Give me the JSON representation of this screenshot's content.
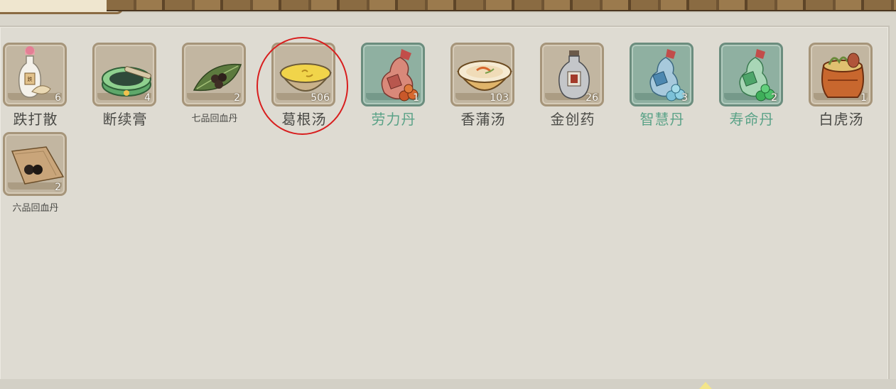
{
  "inventory": {
    "items": [
      {
        "name": "跌打散",
        "count": "6",
        "quality": "normal",
        "icon": "bottle-herb-icon"
      },
      {
        "name": "断续膏",
        "count": "4",
        "quality": "normal",
        "icon": "green-mortar-icon"
      },
      {
        "name": "七品回血丹",
        "count": "2",
        "quality": "normal",
        "icon": "leaf-pills-icon"
      },
      {
        "name": "葛根汤",
        "count": "506",
        "quality": "normal",
        "icon": "yellow-soup-bowl-icon"
      },
      {
        "name": "劳力丹",
        "count": "1",
        "quality": "green",
        "icon": "red-gourd-pills-icon"
      },
      {
        "name": "香蒲汤",
        "count": "103",
        "quality": "normal",
        "icon": "soup-bowl-icon"
      },
      {
        "name": "金创药",
        "count": "26",
        "quality": "normal",
        "icon": "medicine-vase-icon"
      },
      {
        "name": "智慧丹",
        "count": "3",
        "quality": "green",
        "icon": "blue-gourd-pills-icon"
      },
      {
        "name": "寿命丹",
        "count": "2",
        "quality": "green",
        "icon": "green-gourd-pills-icon"
      },
      {
        "name": "白虎汤",
        "count": "1",
        "quality": "normal",
        "icon": "clay-pot-icon"
      },
      {
        "name": "六品回血丹",
        "count": "2",
        "quality": "normal",
        "icon": "paper-pills-icon"
      }
    ]
  },
  "colors": {
    "green_quality": "#5aa287",
    "normal_text": "#4a4a46",
    "highlight": "#d81e1e"
  }
}
